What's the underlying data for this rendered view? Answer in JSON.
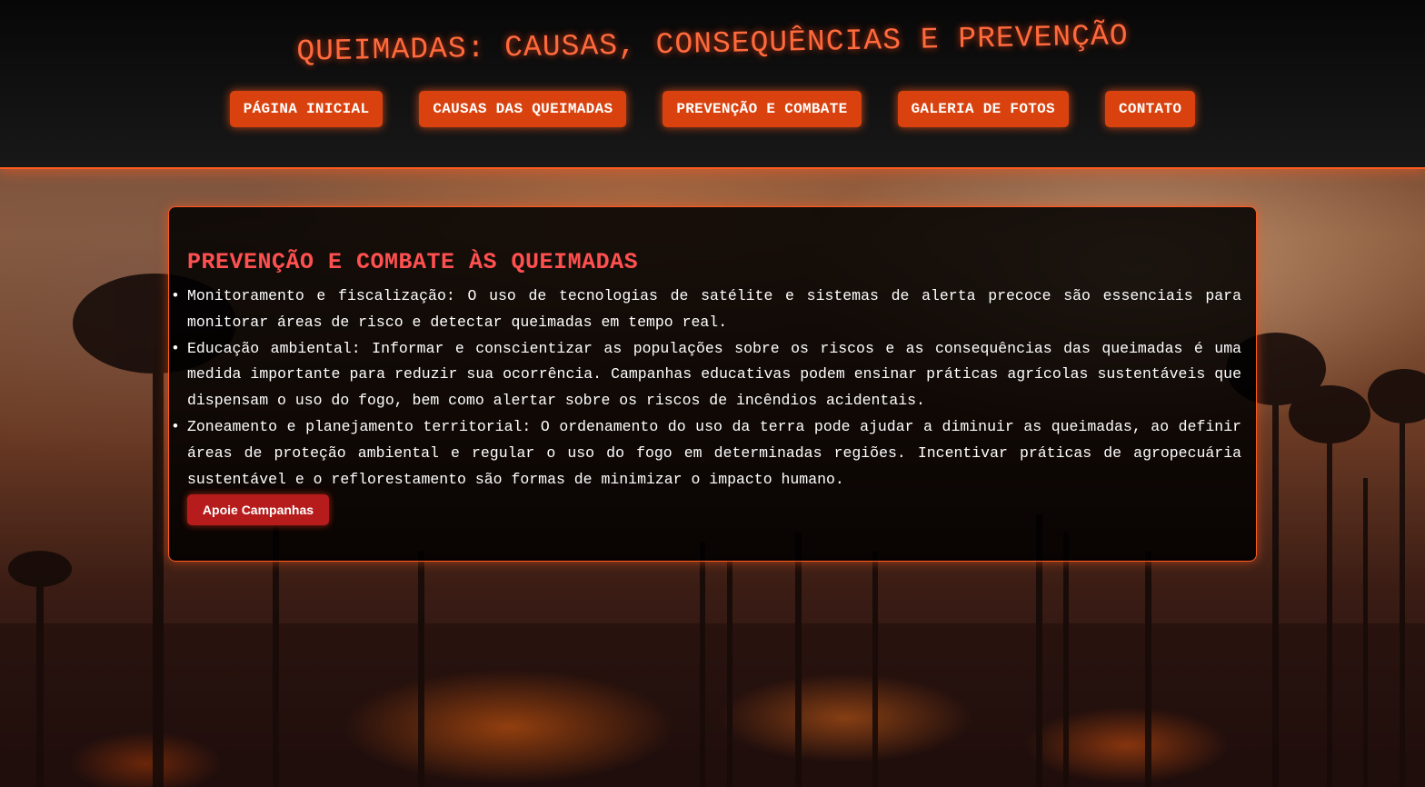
{
  "header": {
    "title": "QUEIMADAS: CAUSAS, CONSEQUÊNCIAS E PREVENÇÃO",
    "nav": [
      {
        "label": "PÁGINA INICIAL"
      },
      {
        "label": "CAUSAS DAS QUEIMADAS"
      },
      {
        "label": "PREVENÇÃO E COMBATE"
      },
      {
        "label": "GALERIA DE FOTOS"
      },
      {
        "label": "CONTATO"
      }
    ]
  },
  "main": {
    "title": "PREVENÇÃO E COMBATE ÀS QUEIMADAS",
    "items": [
      {
        "text": "Monitoramento e fiscalização: O uso de tecnologias de satélite e sistemas de alerta precoce são essenciais para monitorar áreas de risco e detectar queimadas em tempo real."
      },
      {
        "text": "Educação ambiental: Informar e conscientizar as populações sobre os riscos e as consequências das queimadas é uma medida importante para reduzir sua ocorrência. Campanhas educativas podem ensinar práticas agrícolas sustentáveis que dispensam o uso do fogo, bem como alertar sobre os riscos de incêndios acidentais."
      },
      {
        "text": "Zoneamento e planejamento territorial: O ordenamento do uso da terra pode ajudar a diminuir as queimadas, ao definir áreas de proteção ambiental e regular o uso do fogo em determinadas regiões. Incentivar práticas de agropecuária sustentável e o reflorestamento são formas de minimizar o impacto humano."
      }
    ],
    "cta_label": "Apoie Campanhas"
  },
  "colors": {
    "accent": "#ff5a1f",
    "nav_button": "#d9420e",
    "title": "#ff6a3d",
    "section_title": "#ff5050",
    "cta": "#b71c1c"
  }
}
